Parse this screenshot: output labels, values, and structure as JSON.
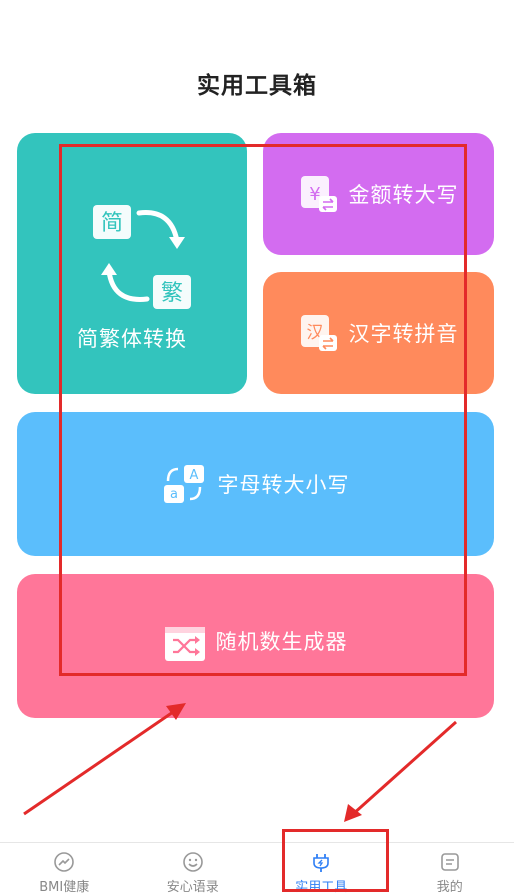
{
  "page": {
    "title": "实用工具箱"
  },
  "tools": {
    "fanjian": {
      "label": "简繁体转换",
      "glyph_simple": "简",
      "glyph_trad": "繁",
      "icon": "convert-arrows-icon",
      "color": "#33c4bd"
    },
    "money": {
      "label": "金额转大写",
      "glyph": "¥",
      "icon": "yen-convert-icon",
      "color": "#d36cf0"
    },
    "pinyin": {
      "label": "汉字转拼音",
      "glyph": "汉",
      "icon": "hanzi-convert-icon",
      "color": "#ff8a5c"
    },
    "case": {
      "label": "字母转大小写",
      "glyph_upper": "A",
      "glyph_lower": "a",
      "icon": "letter-case-icon",
      "color": "#5bbefc"
    },
    "random": {
      "label": "随机数生成器",
      "icon": "shuffle-icon",
      "color": "#ff7699"
    }
  },
  "nav": {
    "items": [
      {
        "label": "BMI健康",
        "icon": "trend-icon",
        "active": false
      },
      {
        "label": "安心语录",
        "icon": "smile-icon",
        "active": false
      },
      {
        "label": "实用工具",
        "icon": "tool-plug-icon",
        "active": true
      },
      {
        "label": "我的",
        "icon": "profile-card-icon",
        "active": false
      }
    ],
    "active_color": "#2f7ff5",
    "inactive_color": "#888888"
  },
  "annotation_color": "#e32a2a"
}
